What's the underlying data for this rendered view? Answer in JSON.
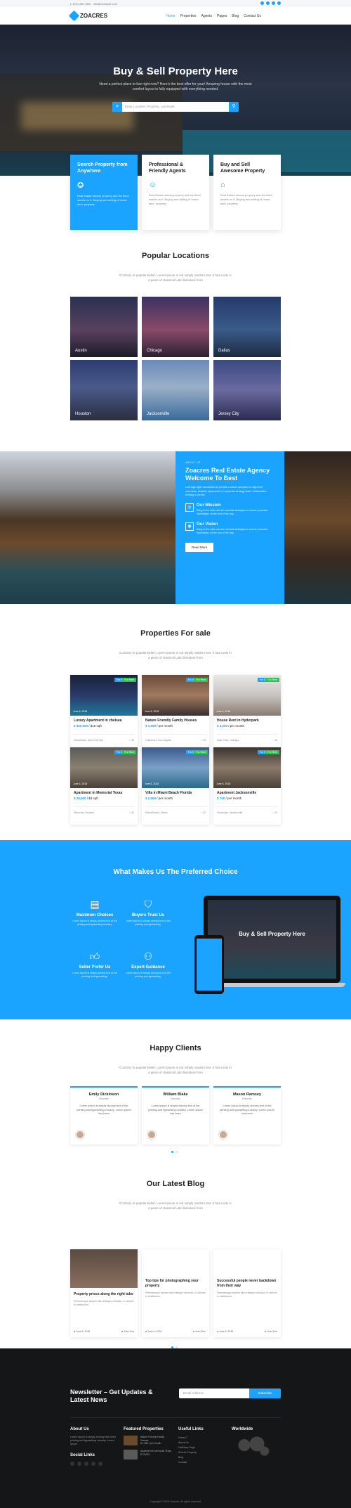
{
  "topbar": {
    "phone": "(+123) 456 7890",
    "email": "info@example.com"
  },
  "brand": {
    "name": "ZOACRES"
  },
  "nav": {
    "items": [
      "Home",
      "Properties",
      "Agents",
      "Pages",
      "Blog",
      "Contact Us"
    ]
  },
  "hero": {
    "title": "Buy & Sell Property Here",
    "subtitle": "Need a perfect place to live right now? Here's the best offer for your! Amazing house with the most comfort layout is fully equipped with everything needed.",
    "search_placeholder": "Enter Location, Property, Landmark"
  },
  "features": [
    {
      "title": "Search Property from Anywhere",
      "icon": "award-icon",
      "text": "Real Estate means property and the fixed assets on it. Buying and selling of home, land, property."
    },
    {
      "title": "Professional & Friendly Agents",
      "icon": "agent-icon",
      "text": "Real Estate means property and the fixed assets on it. Buying and selling of home, land, property."
    },
    {
      "title": "Buy and Sell Awesome Property",
      "icon": "bag-icon",
      "text": "Real Estate means property and the fixed assets on it. Buying and selling of home, land, property."
    }
  ],
  "locations": {
    "title": "Popular Locations",
    "subtitle": "Contrary to popular belief, Lorem Ipsum is not simply random text. It has roots in a piece of classical Latin literature from",
    "items": [
      "Austin",
      "Chicago",
      "Dallas",
      "Houston",
      "Jacksonville",
      "Jersey City"
    ]
  },
  "about": {
    "kicker": "ABOUT US",
    "title": "Zoacres Real Estate Agency Welcome To Best",
    "text": "Leverage agile frameworks to provide a robust synopsis for high level overviews. Iterative approaches to corporate strategy foster collaborative thinking to further",
    "mission_title": "Our Mission",
    "mission_text": "Bring to the table win-win survival strategies to ensure proactive domination. At the end of the day.",
    "vision_title": "Our Vision",
    "vision_text": "Bring to the table win-win survival strategies to ensure proactive domination. At the end of the day.",
    "button": "Read More"
  },
  "properties": {
    "title": "Properties For sale",
    "subtitle": "Contrary to popular belief, Lorem Ipsum is not simply random text. It has roots in a piece of classical Latin literature from",
    "items": [
      {
        "name": "Luxury Apartment in chelsea",
        "price": "$ 450,000",
        "unit": "/ $15 sqft",
        "loc": "Homestead, New York City",
        "tag1": "For Sale",
        "tag2": "For Rent",
        "posted": "June 6, 2018",
        "likes": "42"
      },
      {
        "name": "Nature Friendly Family Houses",
        "price": "$ 1,550",
        "unit": "/ per month",
        "loc": "Hollywood, Los Angeles",
        "tag1": "For Sale",
        "tag2": "For Rent",
        "posted": "June 6, 2018",
        "likes": "42"
      },
      {
        "name": "House Rent in Hyderpark",
        "price": "$ 2,200",
        "unit": "/ per month",
        "loc": "Hyde Park, Chicago",
        "tag1": "For Sale",
        "tag2": "For Rent",
        "posted": "June 6, 2018",
        "likes": "42"
      },
      {
        "name": "Apartment in Memorial Texas",
        "price": "$ 29,000",
        "unit": "/ $4 sqft",
        "loc": "Memorial, Houston",
        "tag1": "For Sale",
        "tag2": "For Rent",
        "posted": "June 6, 2018",
        "likes": "42"
      },
      {
        "name": "Villa in Miami Beach Florida",
        "price": "$ 2,550",
        "unit": "/ per month",
        "loc": "Miami Beach, Miami",
        "tag1": "For Sale",
        "tag2": "For Rent",
        "posted": "June 6, 2018",
        "likes": "42"
      },
      {
        "name": "Apartment Jacksonville",
        "price": "$ 750",
        "unit": "/ per month",
        "loc": "Southside, Jacksonville",
        "tag1": "For Sale",
        "tag2": "For Rent",
        "posted": "June 6, 2018",
        "likes": "42"
      }
    ]
  },
  "choice": {
    "title": "What Makes Us The Preferred Choice",
    "items": [
      {
        "title": "Maximum Choices",
        "text": "Lorem Ipsum is simply dummy text of the printing and typesetting industry."
      },
      {
        "title": "Buyers Trust Us",
        "text": "Lorem Ipsum is simply dummy text of the printing and typesetting."
      },
      {
        "title": "Seller Prefer Us",
        "text": "Lorem Ipsum is simply dummy text of the printing and typesetting."
      },
      {
        "title": "Expert Guidance",
        "text": "Lorem Ipsum is simply dummy text of the printing and typesetting."
      }
    ],
    "laptop_title": "Buy & Sell Property Here"
  },
  "clients": {
    "title": "Happy Clients",
    "subtitle": "Contrary to popular belief, Lorem Ipsum is not simply random text. It has roots in a piece of classical Latin literature from",
    "items": [
      {
        "name": "Emily Dickinson",
        "job": "Executive",
        "text": "Lorem Ipsum is simply dummy text of the printing and typesetting industry. Lorem Ipsum has been"
      },
      {
        "name": "William Blake",
        "job": "Executive",
        "text": "Lorem Ipsum is simply dummy text of the printing and typesetting industry. Lorem Ipsum has been"
      },
      {
        "name": "Mason Ramsey",
        "job": "Executive",
        "text": "Lorem Ipsum is simply dummy text of the printing and typesetting industry. Lorem Ipsum has been"
      }
    ]
  },
  "blog": {
    "title": "Our Latest Blog",
    "subtitle": "Contrary to popular belief, Lorem Ipsum is not simply random text. It has roots in a piece of classical Latin literature from",
    "items": [
      {
        "title": "Property prices along the right tube",
        "text": "Pellentesque laoreet nibh tristique vehicula. In ultrices in vestibulum.",
        "date": "June 6, 2018",
        "author": "John Doe"
      },
      {
        "title": "Top tips for photographing your property",
        "text": "Pellentesque laoreet nibh tristique vehicula. In ultrices in vestibulum.",
        "date": "June 6, 2018",
        "author": "John Doe"
      },
      {
        "title": "Successful people never backdown from their way",
        "text": "Pellentesque laoreet nibh tristique vehicula. In ultrices in vestibulum.",
        "date": "June 6, 2018",
        "author": "John Doe"
      }
    ]
  },
  "footer": {
    "newsletter": "Newsletter – Get Updates & Latest News",
    "email_placeholder": "Email Address",
    "subscribe": "Subscribe",
    "about_title": "About Us",
    "about_text": "Lorem Ipsum is simply dummy text of the printing and typesetting industry. Lorem Ipsum",
    "social_title": "Social Links",
    "featured_title": "Featured Properties",
    "featured": [
      {
        "name": "Nature Friendly Family Houses",
        "price": "$ 1,550 / per month"
      },
      {
        "name": "Apartment in Memorial Texas",
        "price": "$ 29,000"
      }
    ],
    "useful_title": "Useful Links",
    "useful": [
      "Home 2",
      "About Us",
      "Half Map Page",
      "Search Property",
      "Blog",
      "Contact"
    ],
    "world_title": "Worldwide",
    "copyright": "Copyright © 2018 Zoacres. All rights reserved."
  }
}
